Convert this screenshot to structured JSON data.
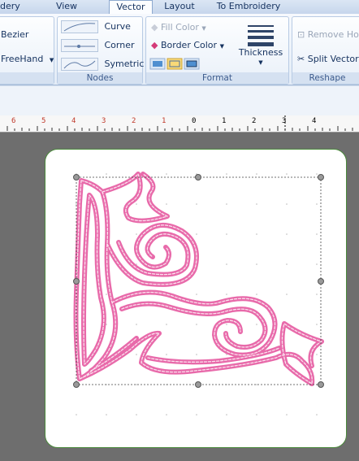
{
  "tabs": [
    {
      "label": "dery",
      "active": false
    },
    {
      "label": "View",
      "active": false
    },
    {
      "label": "Vector",
      "active": true
    },
    {
      "label": "Layout",
      "active": false
    },
    {
      "label": "To Embroidery",
      "active": false
    }
  ],
  "ribbon": {
    "draw": {
      "bezier": "Bezier",
      "freehand": "FreeHand"
    },
    "nodes": {
      "label": "Nodes",
      "curve": "Curve",
      "corner": "Corner",
      "symetric": "Symetric"
    },
    "format": {
      "label": "Format",
      "fill_color": "Fill Color",
      "border_color": "Border Color",
      "thickness": "Thickness"
    },
    "reshape": {
      "label": "Reshape",
      "remove_holes": "Remove Ho",
      "split_vector": "Split Vector"
    }
  },
  "ruler": {
    "labels": [
      "6",
      "5",
      "4",
      "3",
      "2",
      "1",
      "0",
      "1",
      "2",
      "3",
      "4"
    ]
  },
  "colors": {
    "design_pink": "#e86aaa",
    "card_border": "#4b8a3c",
    "workspace": "#6e6e6e"
  }
}
